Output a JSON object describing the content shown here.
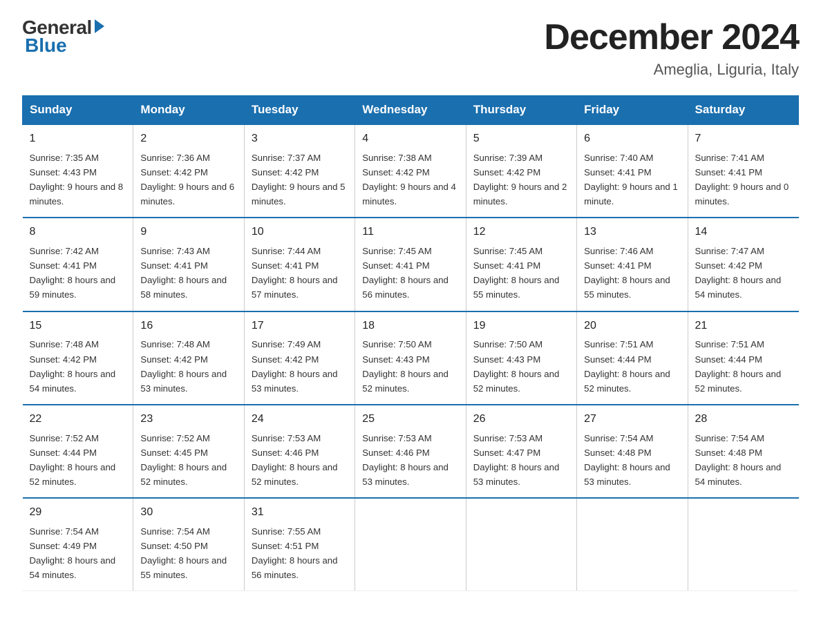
{
  "logo": {
    "general": "General",
    "blue": "Blue"
  },
  "header": {
    "month": "December 2024",
    "location": "Ameglia, Liguria, Italy"
  },
  "weekdays": [
    "Sunday",
    "Monday",
    "Tuesday",
    "Wednesday",
    "Thursday",
    "Friday",
    "Saturday"
  ],
  "weeks": [
    [
      {
        "day": "1",
        "sunrise": "7:35 AM",
        "sunset": "4:43 PM",
        "daylight": "9 hours and 8 minutes."
      },
      {
        "day": "2",
        "sunrise": "7:36 AM",
        "sunset": "4:42 PM",
        "daylight": "9 hours and 6 minutes."
      },
      {
        "day": "3",
        "sunrise": "7:37 AM",
        "sunset": "4:42 PM",
        "daylight": "9 hours and 5 minutes."
      },
      {
        "day": "4",
        "sunrise": "7:38 AM",
        "sunset": "4:42 PM",
        "daylight": "9 hours and 4 minutes."
      },
      {
        "day": "5",
        "sunrise": "7:39 AM",
        "sunset": "4:42 PM",
        "daylight": "9 hours and 2 minutes."
      },
      {
        "day": "6",
        "sunrise": "7:40 AM",
        "sunset": "4:41 PM",
        "daylight": "9 hours and 1 minute."
      },
      {
        "day": "7",
        "sunrise": "7:41 AM",
        "sunset": "4:41 PM",
        "daylight": "9 hours and 0 minutes."
      }
    ],
    [
      {
        "day": "8",
        "sunrise": "7:42 AM",
        "sunset": "4:41 PM",
        "daylight": "8 hours and 59 minutes."
      },
      {
        "day": "9",
        "sunrise": "7:43 AM",
        "sunset": "4:41 PM",
        "daylight": "8 hours and 58 minutes."
      },
      {
        "day": "10",
        "sunrise": "7:44 AM",
        "sunset": "4:41 PM",
        "daylight": "8 hours and 57 minutes."
      },
      {
        "day": "11",
        "sunrise": "7:45 AM",
        "sunset": "4:41 PM",
        "daylight": "8 hours and 56 minutes."
      },
      {
        "day": "12",
        "sunrise": "7:45 AM",
        "sunset": "4:41 PM",
        "daylight": "8 hours and 55 minutes."
      },
      {
        "day": "13",
        "sunrise": "7:46 AM",
        "sunset": "4:41 PM",
        "daylight": "8 hours and 55 minutes."
      },
      {
        "day": "14",
        "sunrise": "7:47 AM",
        "sunset": "4:42 PM",
        "daylight": "8 hours and 54 minutes."
      }
    ],
    [
      {
        "day": "15",
        "sunrise": "7:48 AM",
        "sunset": "4:42 PM",
        "daylight": "8 hours and 54 minutes."
      },
      {
        "day": "16",
        "sunrise": "7:48 AM",
        "sunset": "4:42 PM",
        "daylight": "8 hours and 53 minutes."
      },
      {
        "day": "17",
        "sunrise": "7:49 AM",
        "sunset": "4:42 PM",
        "daylight": "8 hours and 53 minutes."
      },
      {
        "day": "18",
        "sunrise": "7:50 AM",
        "sunset": "4:43 PM",
        "daylight": "8 hours and 52 minutes."
      },
      {
        "day": "19",
        "sunrise": "7:50 AM",
        "sunset": "4:43 PM",
        "daylight": "8 hours and 52 minutes."
      },
      {
        "day": "20",
        "sunrise": "7:51 AM",
        "sunset": "4:44 PM",
        "daylight": "8 hours and 52 minutes."
      },
      {
        "day": "21",
        "sunrise": "7:51 AM",
        "sunset": "4:44 PM",
        "daylight": "8 hours and 52 minutes."
      }
    ],
    [
      {
        "day": "22",
        "sunrise": "7:52 AM",
        "sunset": "4:44 PM",
        "daylight": "8 hours and 52 minutes."
      },
      {
        "day": "23",
        "sunrise": "7:52 AM",
        "sunset": "4:45 PM",
        "daylight": "8 hours and 52 minutes."
      },
      {
        "day": "24",
        "sunrise": "7:53 AM",
        "sunset": "4:46 PM",
        "daylight": "8 hours and 52 minutes."
      },
      {
        "day": "25",
        "sunrise": "7:53 AM",
        "sunset": "4:46 PM",
        "daylight": "8 hours and 53 minutes."
      },
      {
        "day": "26",
        "sunrise": "7:53 AM",
        "sunset": "4:47 PM",
        "daylight": "8 hours and 53 minutes."
      },
      {
        "day": "27",
        "sunrise": "7:54 AM",
        "sunset": "4:48 PM",
        "daylight": "8 hours and 53 minutes."
      },
      {
        "day": "28",
        "sunrise": "7:54 AM",
        "sunset": "4:48 PM",
        "daylight": "8 hours and 54 minutes."
      }
    ],
    [
      {
        "day": "29",
        "sunrise": "7:54 AM",
        "sunset": "4:49 PM",
        "daylight": "8 hours and 54 minutes."
      },
      {
        "day": "30",
        "sunrise": "7:54 AM",
        "sunset": "4:50 PM",
        "daylight": "8 hours and 55 minutes."
      },
      {
        "day": "31",
        "sunrise": "7:55 AM",
        "sunset": "4:51 PM",
        "daylight": "8 hours and 56 minutes."
      },
      null,
      null,
      null,
      null
    ]
  ]
}
